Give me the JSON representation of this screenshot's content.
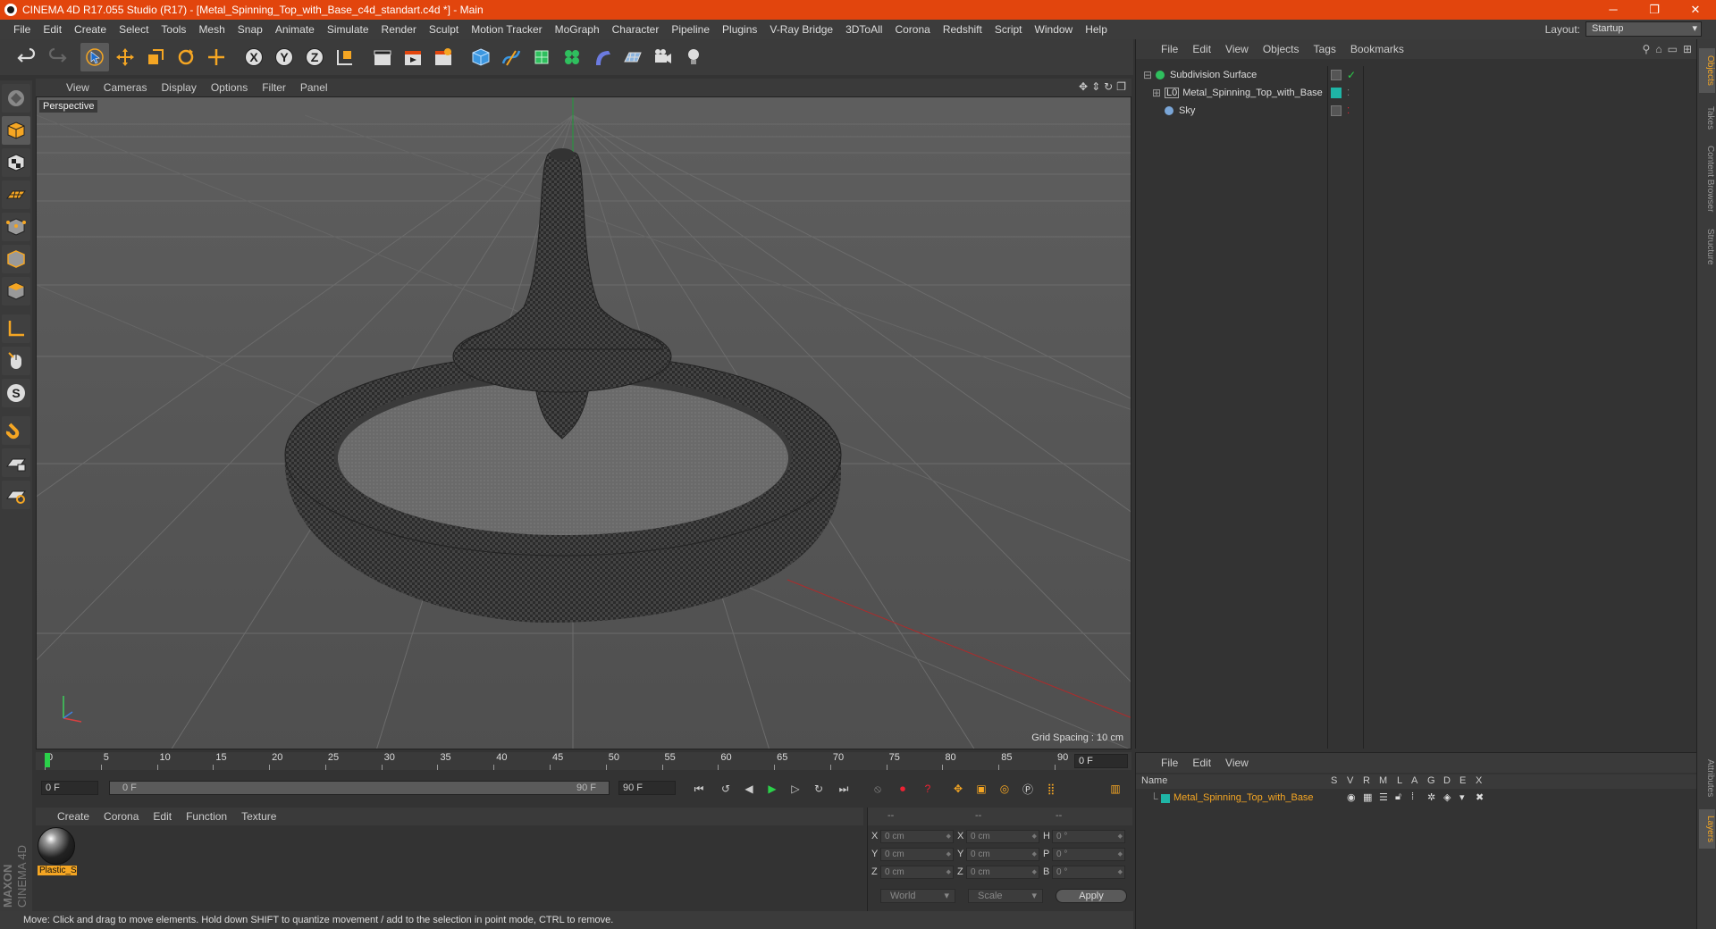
{
  "window": {
    "title": "CINEMA 4D R17.055 Studio (R17) - [Metal_Spinning_Top_with_Base_c4d_standart.c4d *] - Main",
    "minimize": "─",
    "maximize": "❐",
    "close": "✕"
  },
  "menu": [
    "File",
    "Edit",
    "Create",
    "Select",
    "Tools",
    "Mesh",
    "Snap",
    "Animate",
    "Simulate",
    "Render",
    "Sculpt",
    "Motion Tracker",
    "MoGraph",
    "Character",
    "Pipeline",
    "Plugins",
    "V-Ray Bridge",
    "3DToAll",
    "Corona",
    "Redshift",
    "Script",
    "Window",
    "Help"
  ],
  "layout": {
    "label": "Layout:",
    "value": "Startup"
  },
  "viewport": {
    "menu": [
      "View",
      "Cameras",
      "Display",
      "Options",
      "Filter",
      "Panel"
    ],
    "camera": "Perspective",
    "grid_spacing": "Grid Spacing : 10 cm"
  },
  "timeline": {
    "ticks": [
      "0",
      "5",
      "10",
      "15",
      "20",
      "25",
      "30",
      "35",
      "40",
      "45",
      "50",
      "55",
      "60",
      "65",
      "70",
      "75",
      "80",
      "85",
      "90"
    ],
    "current": "0 F",
    "start": "0 F",
    "range_start": "0 F",
    "range_end": "90 F",
    "end": "90 F"
  },
  "material_manager": {
    "menu": [
      "Create",
      "Corona",
      "Edit",
      "Function",
      "Texture"
    ],
    "materials": [
      {
        "name": "Plastic_S"
      }
    ]
  },
  "coordinates": {
    "headers": [
      "--",
      "--",
      "--"
    ],
    "rows": [
      {
        "a": "X",
        "pos": "0 cm",
        "b": "X",
        "size": "0 cm",
        "c": "H",
        "rot": "0 °"
      },
      {
        "a": "Y",
        "pos": "0 cm",
        "b": "Y",
        "size": "0 cm",
        "c": "P",
        "rot": "0 °"
      },
      {
        "a": "Z",
        "pos": "0 cm",
        "b": "Z",
        "size": "0 cm",
        "c": "B",
        "rot": "0 °"
      }
    ],
    "world": "World",
    "scale": "Scale",
    "apply": "Apply"
  },
  "object_manager": {
    "menu": [
      "File",
      "Edit",
      "View",
      "Objects",
      "Tags",
      "Bookmarks"
    ],
    "objects": [
      {
        "name": "Subdivision Surface"
      },
      {
        "name": "Metal_Spinning_Top_with_Base"
      },
      {
        "name": "Sky"
      }
    ]
  },
  "layer_manager": {
    "menu": [
      "File",
      "Edit",
      "View"
    ],
    "columns": [
      "Name",
      "S",
      "V",
      "R",
      "M",
      "L",
      "A",
      "G",
      "D",
      "E",
      "X"
    ],
    "layers": [
      {
        "name": "Metal_Spinning_Top_with_Base",
        "color": "#1fb5a6"
      }
    ]
  },
  "right_tabs": [
    "Objects",
    "Takes",
    "Content Browser",
    "Structure",
    "Attributes",
    "Layers"
  ],
  "status": "Move: Click and drag to move elements. Hold down SHIFT to quantize movement / add to the selection in point mode, CTRL to remove.",
  "branding": {
    "line1": "MAXON",
    "line2": "CINEMA 4D"
  },
  "colors": {
    "accent": "#e2450d",
    "selection": "#f5a623",
    "layer": "#1fb5a6"
  }
}
